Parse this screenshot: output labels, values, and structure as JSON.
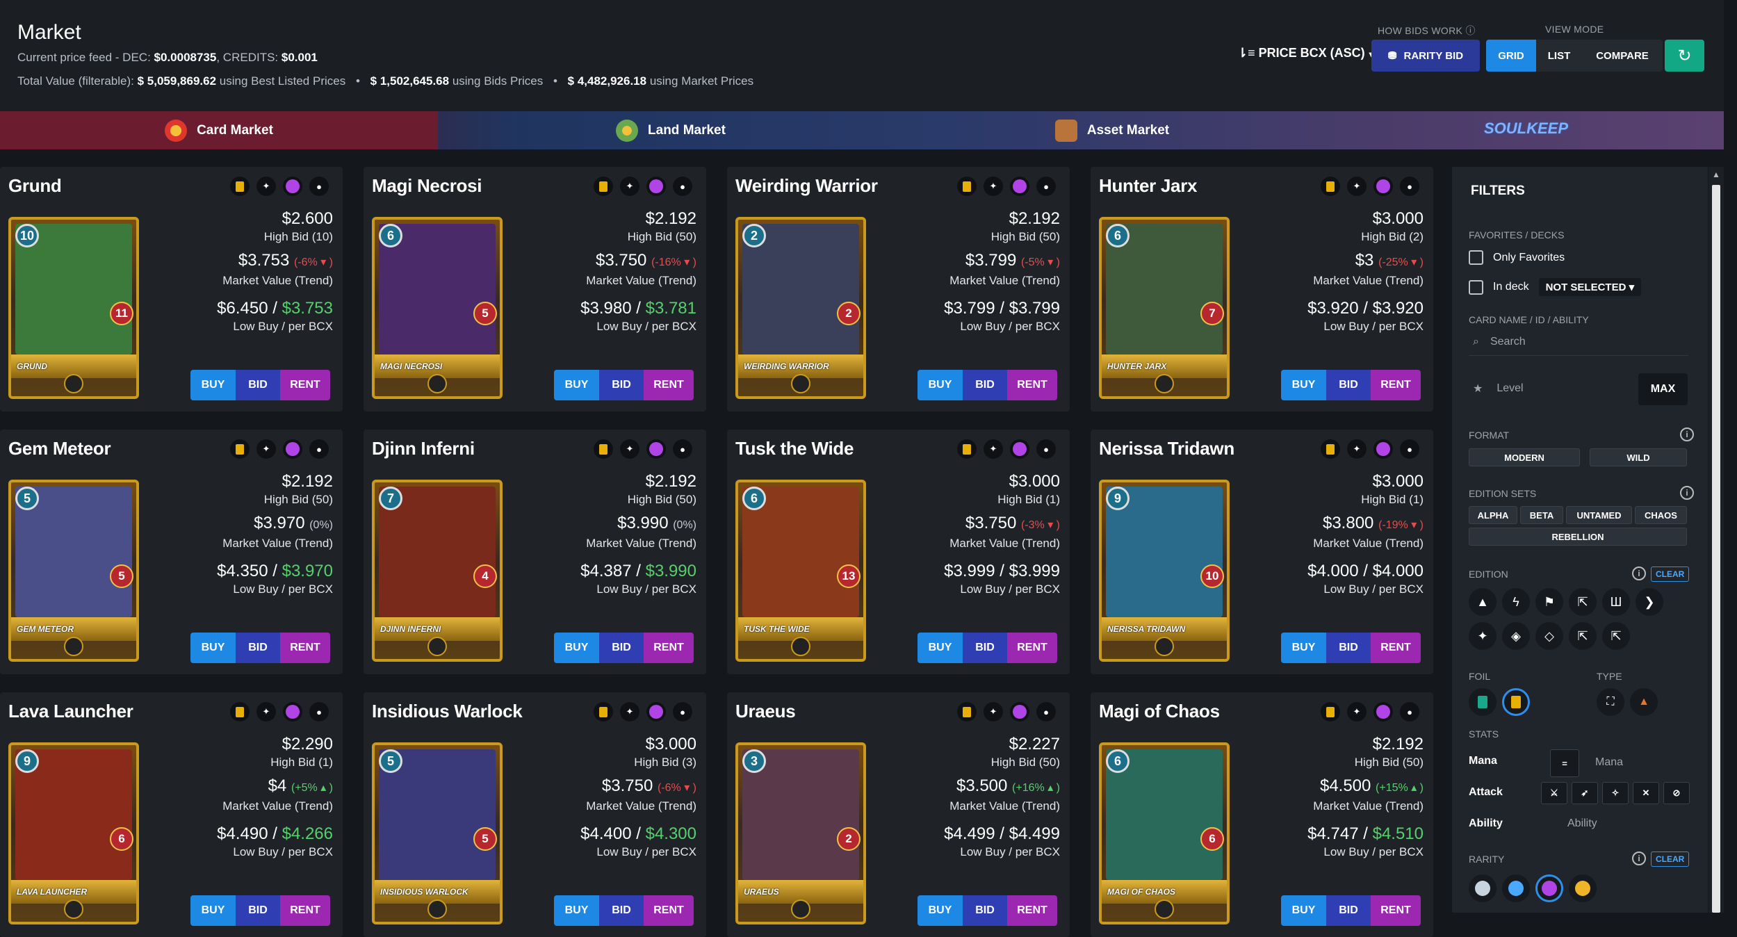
{
  "header": {
    "title": "Market",
    "feed_label": "Current price feed - DEC:",
    "feed_dec": "$0.0008735",
    "feed_credits_label": ", CREDITS:",
    "feed_credits": "$0.001",
    "total_label": "Total Value (filterable):",
    "total_best": "$ 5,059,869.62",
    "total_best_suffix": "using Best Listed Prices",
    "total_bids": "$ 1,502,645.68",
    "total_bids_suffix": "using Bids Prices",
    "total_market": "$ 4,482,926.18",
    "total_market_suffix": "using Market Prices",
    "sort_label": "PRICE BCX (ASC)",
    "how_bids_work": "HOW BIDS WORK",
    "view_mode_label": "VIEW MODE",
    "rarity_bid": "RARITY BID",
    "view_modes": [
      "GRID",
      "LIST",
      "COMPARE"
    ]
  },
  "tabs": [
    {
      "label": "Card Market",
      "color": "#e0362c"
    },
    {
      "label": "Land Market",
      "color": "#6aa84f"
    },
    {
      "label": "Asset Market",
      "color": "#b8743a"
    }
  ],
  "soulkeep_logo": "SOULKEEP",
  "labels": {
    "high_bid": "High Bid",
    "market_value": "Market Value (Trend)",
    "low_buy": "Low Buy / per BCX",
    "buy": "BUY",
    "bid": "BID",
    "rent": "RENT"
  },
  "cards": [
    {
      "name": "Grund",
      "bid": "$2.600",
      "high_bid_n": "High Bid (10)",
      "mv": "$3.753",
      "trend": "(-6% ▾ )",
      "trend_dir": "neg",
      "low": "$6.450 /",
      "per": "$3.753",
      "per_green": true,
      "level": "10",
      "atk": "11",
      "label": "GRUND",
      "art": "#3b7a3a"
    },
    {
      "name": "Magi Necrosi",
      "bid": "$2.192",
      "high_bid_n": "High Bid (50)",
      "mv": "$3.750",
      "trend": "(-16% ▾ )",
      "trend_dir": "neg",
      "low": "$3.980 /",
      "per": "$3.781",
      "per_green": true,
      "level": "6",
      "atk": "5",
      "label": "MAGI NECROSI",
      "art": "#4b2a6a"
    },
    {
      "name": "Weirding Warrior",
      "bid": "$2.192",
      "high_bid_n": "High Bid (50)",
      "mv": "$3.799",
      "trend": "(-5% ▾ )",
      "trend_dir": "neg",
      "low": "$3.799 /",
      "per": "$3.799",
      "per_green": false,
      "level": "2",
      "atk": "2",
      "label": "WEIRDING WARRIOR",
      "art": "#3a3f5a"
    },
    {
      "name": "Hunter Jarx",
      "bid": "$3.000",
      "high_bid_n": "High Bid (2)",
      "mv": "$3",
      "trend": "(-25% ▾ )",
      "trend_dir": "neg",
      "low": "$3.920 /",
      "per": "$3.920",
      "per_green": false,
      "level": "6",
      "atk": "7",
      "label": "HUNTER JARX",
      "art": "#3f5a3a"
    },
    {
      "name": "Gem Meteor",
      "bid": "$2.192",
      "high_bid_n": "High Bid (50)",
      "mv": "$3.970",
      "trend": "(0%)",
      "trend_dir": "neu",
      "low": "$4.350 /",
      "per": "$3.970",
      "per_green": true,
      "level": "5",
      "atk": "5",
      "label": "GEM METEOR",
      "art": "#4a4f8a"
    },
    {
      "name": "Djinn Inferni",
      "bid": "$2.192",
      "high_bid_n": "High Bid (50)",
      "mv": "$3.990",
      "trend": "(0%)",
      "trend_dir": "neu",
      "low": "$4.387 /",
      "per": "$3.990",
      "per_green": true,
      "level": "7",
      "atk": "4",
      "label": "DJINN INFERNI",
      "art": "#7a2a1a"
    },
    {
      "name": "Tusk the Wide",
      "bid": "$3.000",
      "high_bid_n": "High Bid (1)",
      "mv": "$3.750",
      "trend": "(-3% ▾ )",
      "trend_dir": "neg",
      "low": "$3.999 /",
      "per": "$3.999",
      "per_green": false,
      "level": "6",
      "atk": "13",
      "label": "TUSK THE WIDE",
      "art": "#8a3a1a"
    },
    {
      "name": "Nerissa Tridawn",
      "bid": "$3.000",
      "high_bid_n": "High Bid (1)",
      "mv": "$3.800",
      "trend": "(-19% ▾ )",
      "trend_dir": "neg",
      "low": "$4.000 /",
      "per": "$4.000",
      "per_green": false,
      "level": "9",
      "atk": "10",
      "label": "NERISSA TRIDAWN",
      "art": "#2a6a8a"
    },
    {
      "name": "Lava Launcher",
      "bid": "$2.290",
      "high_bid_n": "High Bid (1)",
      "mv": "$4",
      "trend": "(+5% ▴ )",
      "trend_dir": "pos",
      "low": "$4.490 /",
      "per": "$4.266",
      "per_green": true,
      "level": "9",
      "atk": "6",
      "label": "LAVA LAUNCHER",
      "art": "#8a2a1a"
    },
    {
      "name": "Insidious Warlock",
      "bid": "$3.000",
      "high_bid_n": "High Bid (3)",
      "mv": "$3.750",
      "trend": "(-6% ▾ )",
      "trend_dir": "neg",
      "low": "$4.400 /",
      "per": "$4.300",
      "per_green": true,
      "level": "5",
      "atk": "5",
      "label": "INSIDIOUS WARLOCK",
      "art": "#3a3a7a"
    },
    {
      "name": "Uraeus",
      "bid": "$2.227",
      "high_bid_n": "High Bid (50)",
      "mv": "$3.500",
      "trend": "(+16% ▴ )",
      "trend_dir": "pos",
      "low": "$4.499 /",
      "per": "$4.499",
      "per_green": false,
      "level": "3",
      "atk": "2",
      "label": "URAEUS",
      "art": "#5a3a4a"
    },
    {
      "name": "Magi of Chaos",
      "bid": "$2.192",
      "high_bid_n": "High Bid (50)",
      "mv": "$4.500",
      "trend": "(+15% ▴ )",
      "trend_dir": "pos",
      "low": "$4.747 /",
      "per": "$4.510",
      "per_green": true,
      "level": "6",
      "atk": "6",
      "label": "MAGI OF CHAOS",
      "art": "#2a6a5a"
    }
  ],
  "filters": {
    "title": "FILTERS",
    "fav_section": "FAVORITES / DECKS",
    "only_favorites": "Only Favorites",
    "in_deck": "In deck",
    "deck_value": "NOT SELECTED",
    "name_section": "CARD NAME / ID / ABILITY",
    "search_placeholder": "Search",
    "level_placeholder": "Level",
    "max": "MAX",
    "format": "FORMAT",
    "format_opts": [
      "MODERN",
      "WILD"
    ],
    "edition_sets": "EDITION SETS",
    "sets": [
      "ALPHA",
      "BETA",
      "UNTAMED",
      "CHAOS",
      "REBELLION"
    ],
    "edition": "EDITION",
    "clear": "CLEAR",
    "foil": "FOIL",
    "type": "TYPE",
    "stats": "STATS",
    "mana": "Mana",
    "mana_eq": "=",
    "mana_placeholder": "Mana",
    "attack": "Attack",
    "ability": "Ability",
    "ability_placeholder": "Ability",
    "rarity": "RARITY",
    "rarity_colors": [
      "#c7d3de",
      "#4aa8ff",
      "#b044e6",
      "#f0b429"
    ]
  }
}
